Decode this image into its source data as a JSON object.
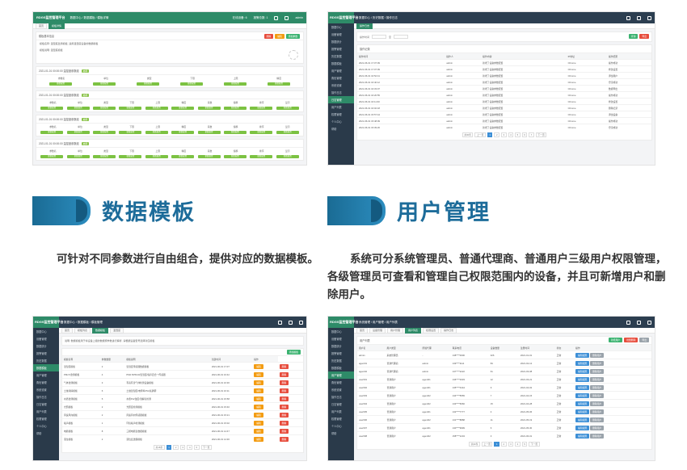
{
  "screenshots": {
    "tl": {
      "brand": "RDGS监控管理平台",
      "crumbs": "数据中心 / 数据模板 / 模板详情",
      "info": [
        "在线设备: 6",
        "报警总数: 1"
      ],
      "user": "admin",
      "tabs": [
        "首页",
        "模板详情"
      ],
      "panel_title": "模板基本信息",
      "panel_lines": [
        "模板名称:  温湿度监测模板,  适用温湿度设备的数据模板",
        "模板说明:  温湿度模板"
      ],
      "buttons": [
        "删除",
        "编辑",
        "添加参数"
      ],
      "groups": [
        {
          "title": "2021-01-01 00:00:00 温湿度参数组",
          "tag": "启用",
          "headers": [
            "参数名",
            "单位",
            "类型",
            "下限",
            "上限",
            "精度"
          ]
        },
        {
          "title": "2021-01-01 00:00:00 温湿度参数组",
          "tag": "启用",
          "headers": [
            "参数名",
            "单位",
            "类型",
            "下限",
            "上限",
            "精度",
            "系数",
            "偏移",
            "排序",
            "显示"
          ]
        },
        {
          "title": "2021-01-01 00:00:00 温湿度参数组",
          "tag": "启用",
          "headers": [
            "参数名",
            "单位",
            "类型",
            "下限",
            "上限",
            "精度",
            "系数",
            "偏移",
            "排序",
            "显示"
          ]
        },
        {
          "title": "2021-01-01 00:00:00 温湿度参数组",
          "tag": "启用",
          "headers": [
            "参数名",
            "单位",
            "类型",
            "下限",
            "上限",
            "精度",
            "系数",
            "偏移",
            "排序",
            "显示"
          ]
        }
      ],
      "bar_label": "参数配置"
    },
    "tr": {
      "brand": "RDGS监控管理平台",
      "crumbs": "数据中心 / 历史数据 / 操作日志",
      "tabs": [
        "操作日志"
      ],
      "search_labels": [
        "操作时间",
        "至"
      ],
      "buttons": [
        "查询",
        "导出"
      ],
      "table_title": "操作记录",
      "headers": [
        "操作时间",
        "操作人",
        "操作内容",
        "IP地址",
        "操作结果"
      ],
      "rows": [
        [
          "2021-06-01 17:07:09",
          "admin",
          "新增了设备参数配置",
          "Chrome",
          "操作成功"
        ],
        [
          "2021-06-01 17:07:09",
          "admin",
          "新增了设备参数配置",
          "Chrome",
          "修改设置"
        ],
        [
          "2021-06-01 16:52:41",
          "admin",
          "新增了设备参数配置",
          "Chrome",
          "添加用户"
        ],
        [
          "2021-06-01 16:40:12",
          "admin",
          "新增了设备参数配置",
          "Chrome",
          "登录成功"
        ],
        [
          "2021-06-01 16:33:07",
          "admin",
          "新增了设备参数配置",
          "Chrome",
          "数据导出"
        ],
        [
          "2021-06-01 16:20:55",
          "admin",
          "新增了设备参数配置",
          "Chrome",
          "操作成功"
        ],
        [
          "2021-06-01 16:11:30",
          "admin",
          "新增了设备参数配置",
          "Chrome",
          "修改设置"
        ],
        [
          "2021-06-01 16:02:18",
          "admin",
          "新增了设备参数配置",
          "Chrome",
          "删除记录"
        ],
        [
          "2021-06-01 15:57:44",
          "admin",
          "新增了设备参数配置",
          "Chrome",
          "添加设备"
        ],
        [
          "2021-06-01 15:48:09",
          "admin",
          "新增了设备参数配置",
          "Chrome",
          "操作成功"
        ],
        [
          "2021-06-01 15:39:26",
          "admin",
          "新增了设备参数配置",
          "Chrome",
          "登录成功"
        ]
      ],
      "pager": [
        "共30条",
        "上一页",
        "1",
        "2",
        "3",
        "4",
        "5",
        "6",
        "7",
        "下一页"
      ]
    },
    "bl": {
      "brand": "RDGS监控管理平台",
      "crumbs": "数据中心 / 数据模板 / 模板管理",
      "tabs": [
        "首页",
        "模板列表",
        "数据模板",
        "温湿度"
      ],
      "desc": "说明: 数据模板用于将设备上报的数据按参数进行解析, 请根据设备型号选择对应模板",
      "add_btn": "添加模板",
      "headers": [
        "模板名称",
        "参数数量",
        "模板说明",
        "创建时间",
        "操作"
      ],
      "rows": [
        [
          "温湿度模板",
          "2",
          "温湿度传感器数据模板",
          "2021-06-01 17:07",
          "编辑",
          "删除"
        ],
        [
          "PM2.5监测模板",
          "4",
          "PM2.5/PM10/温湿度/噪声四合一传感器",
          "2021-06-01 16:42",
          "编辑",
          "删除"
        ],
        [
          "气体监测模板",
          "3",
          "有毒有害气体检测设备模板",
          "2021-06-01 16:30",
          "编辑",
          "删除"
        ],
        [
          "土壤墒情模板",
          "6",
          "土壤温湿度/电导率/PH/氮磷钾",
          "2021-06-01 16:11",
          "编辑",
          "删除"
        ],
        [
          "水质监测模板",
          "5",
          "水质PH/浊度/溶解氧检测",
          "2021-06-01 15:58",
          "编辑",
          "删除"
        ],
        [
          "光照模板",
          "2",
          "光照度检测模板",
          "2021-06-01 15:40",
          "编辑",
          "删除"
        ],
        [
          "风速风向模板",
          "2",
          "风速风向传感器模板",
          "2021-06-01 15:21",
          "编辑",
          "删除"
        ],
        [
          "噪声模板",
          "1",
          "环境噪声检测模板",
          "2021-06-01 15:02",
          "编辑",
          "删除"
        ],
        [
          "电能模板",
          "8",
          "三相电能表数据模板",
          "2021-06-01 14:47",
          "编辑",
          "删除"
        ],
        [
          "液位模板",
          "2",
          "液位变送器模板",
          "2021-06-01 14:30",
          "编辑",
          "删除"
        ]
      ],
      "pager": [
        "共18条",
        "1",
        "2",
        "3",
        "4",
        "5",
        "下一页"
      ]
    },
    "br": {
      "brand": "RDGS监控管理平台",
      "crumbs": "系统管理 / 用户管理 / 用户列表",
      "tabs": [
        "首页",
        "设备管理",
        "用户管理",
        "用户列表",
        "权限设置",
        "操作日志"
      ],
      "table_title": "用户列表",
      "headers": [
        "用户名",
        "用户类型",
        "所属代理",
        "联系电话",
        "设备数量",
        "注册时间",
        "状态",
        "操作"
      ],
      "rows": [
        [
          "admin",
          "系统管理员",
          "-",
          "138****0000",
          "326",
          "2021-01-01",
          "正常"
        ],
        [
          "agent01",
          "普通代理商",
          "admin",
          "139****1111",
          "84",
          "2021-02-12",
          "正常"
        ],
        [
          "agent02",
          "普通代理商",
          "admin",
          "137****2222",
          "61",
          "2021-03-08",
          "正常"
        ],
        [
          "user001",
          "普通用户",
          "agent01",
          "136****3333",
          "12",
          "2021-03-21",
          "正常"
        ],
        [
          "user002",
          "普通用户",
          "agent01",
          "135****4444",
          "9",
          "2021-04-02",
          "正常"
        ],
        [
          "user003",
          "普通用户",
          "agent02",
          "134****5555",
          "7",
          "2021-04-15",
          "正常"
        ],
        [
          "user004",
          "普通用户",
          "agent02",
          "133****6666",
          "15",
          "2021-04-28",
          "正常"
        ],
        [
          "user005",
          "普通用户",
          "agent01",
          "132****7777",
          "4",
          "2021-05-06",
          "正常"
        ],
        [
          "user006",
          "普通用户",
          "agent02",
          "131****8888",
          "11",
          "2021-05-19",
          "正常"
        ],
        [
          "user007",
          "普通用户",
          "agent01",
          "130****9999",
          "6",
          "2021-05-30",
          "正常"
        ],
        [
          "user008",
          "普通用户",
          "agent02",
          "158****1234",
          "3",
          "2021-06-01",
          "正常"
        ]
      ],
      "row_buttons": [
        "编辑权限",
        "删除用户"
      ],
      "top_buttons": [
        "新增用户",
        "批量删除",
        "导出"
      ],
      "pager": [
        "共30条",
        "上一页",
        "1",
        "2",
        "3",
        "4",
        "5",
        "下一页"
      ]
    }
  },
  "features": {
    "template": {
      "title": "数据模板",
      "desc": "可针对不同参数进行自由组合，提供对应的数据模板。"
    },
    "user": {
      "title": "用户管理",
      "desc": "系统可分系统管理员、普通代理商、普通用户三级用户权限管理，各级管理员可查看和管理自己权限范围内的设备，并且可新增用户和删除用户。"
    }
  },
  "colors": {
    "accent": "#1d6c9a",
    "green": "#2e8b68",
    "sidebar": "#2a3a4a"
  },
  "sidebar_items": [
    "数据中心",
    "设备管理",
    "数据统计",
    "报警管理",
    "历史数据",
    "数据模板",
    "用户管理",
    "角色管理",
    "系统设置",
    "操作日志",
    "日志管理",
    "用户列表",
    "权限管理",
    "个人中心",
    "帮助"
  ]
}
